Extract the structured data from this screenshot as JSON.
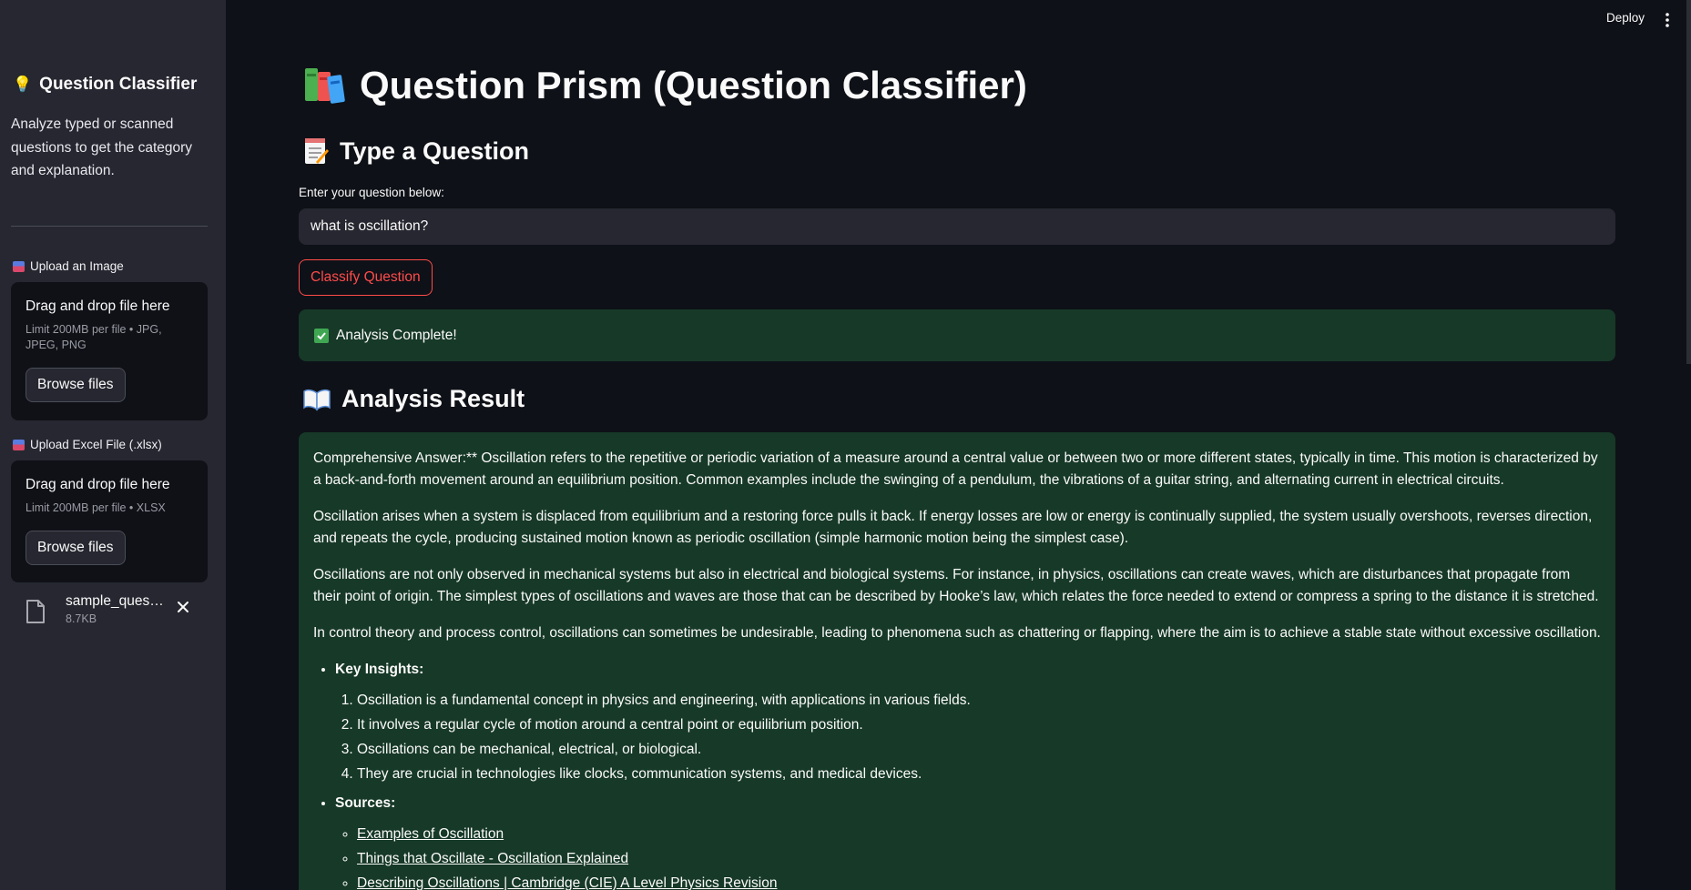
{
  "sidebar": {
    "title": "Question Classifier",
    "description": "Analyze typed or scanned questions to get the category and explanation.",
    "image_upload": {
      "label": "Upload an Image",
      "drop_text": "Drag and drop file here",
      "limit_text": "Limit 200MB per file • JPG, JPEG, PNG",
      "browse_label": "Browse files"
    },
    "excel_upload": {
      "label": "Upload Excel File (.xlsx)",
      "drop_text": "Drag and drop file here",
      "limit_text": "Limit 200MB per file • XLSX",
      "browse_label": "Browse files"
    },
    "uploaded_file": {
      "name": "sample_questions.xlsx",
      "size": "8.7KB"
    }
  },
  "topbar": {
    "deploy_label": "Deploy"
  },
  "main": {
    "title": "Question Prism (Question Classifier)",
    "type_heading": "Type a Question",
    "input_label": "Enter your question below:",
    "input_value": "what is oscillation?",
    "classify_label": "Classify Question",
    "success_text": "Analysis Complete!",
    "result_heading": "Analysis Result",
    "result": {
      "paragraphs": [
        "Comprehensive Answer:** Oscillation refers to the repetitive or periodic variation of a measure around a central value or between two or more different states, typically in time. This motion is characterized by a back-and-forth movement around an equilibrium position. Common examples include the swinging of a pendulum, the vibrations of a guitar string, and alternating current in electrical circuits.",
        "Oscillation arises when a system is displaced from equilibrium and a restoring force pulls it back. If energy losses are low or energy is continually supplied, the system usually overshoots, reverses direction, and repeats the cycle, producing sustained motion known as periodic oscillation (simple harmonic motion being the simplest case).",
        "Oscillations are not only observed in mechanical systems but also in electrical and biological systems. For instance, in physics, oscillations can create waves, which are disturbances that propagate from their point of origin. The simplest types of oscillations and waves are those that can be described by Hooke’s law, which relates the force needed to extend or compress a spring to the distance it is stretched.",
        "In control theory and process control, oscillations can sometimes be undesirable, leading to phenomena such as chattering or flapping, where the aim is to achieve a stable state without excessive oscillation."
      ],
      "insights_label": "Key Insights:",
      "insights": [
        "Oscillation is a fundamental concept in physics and engineering, with applications in various fields.",
        "It involves a regular cycle of motion around a central point or equilibrium position.",
        "Oscillations can be mechanical, electrical, or biological.",
        "They are crucial in technologies like clocks, communication systems, and medical devices."
      ],
      "sources_label": "Sources:",
      "sources": [
        "Examples of Oscillation",
        "Things that Oscillate - Oscillation Explained",
        "Describing Oscillations | Cambridge (CIE) A Level Physics Revision"
      ]
    }
  }
}
